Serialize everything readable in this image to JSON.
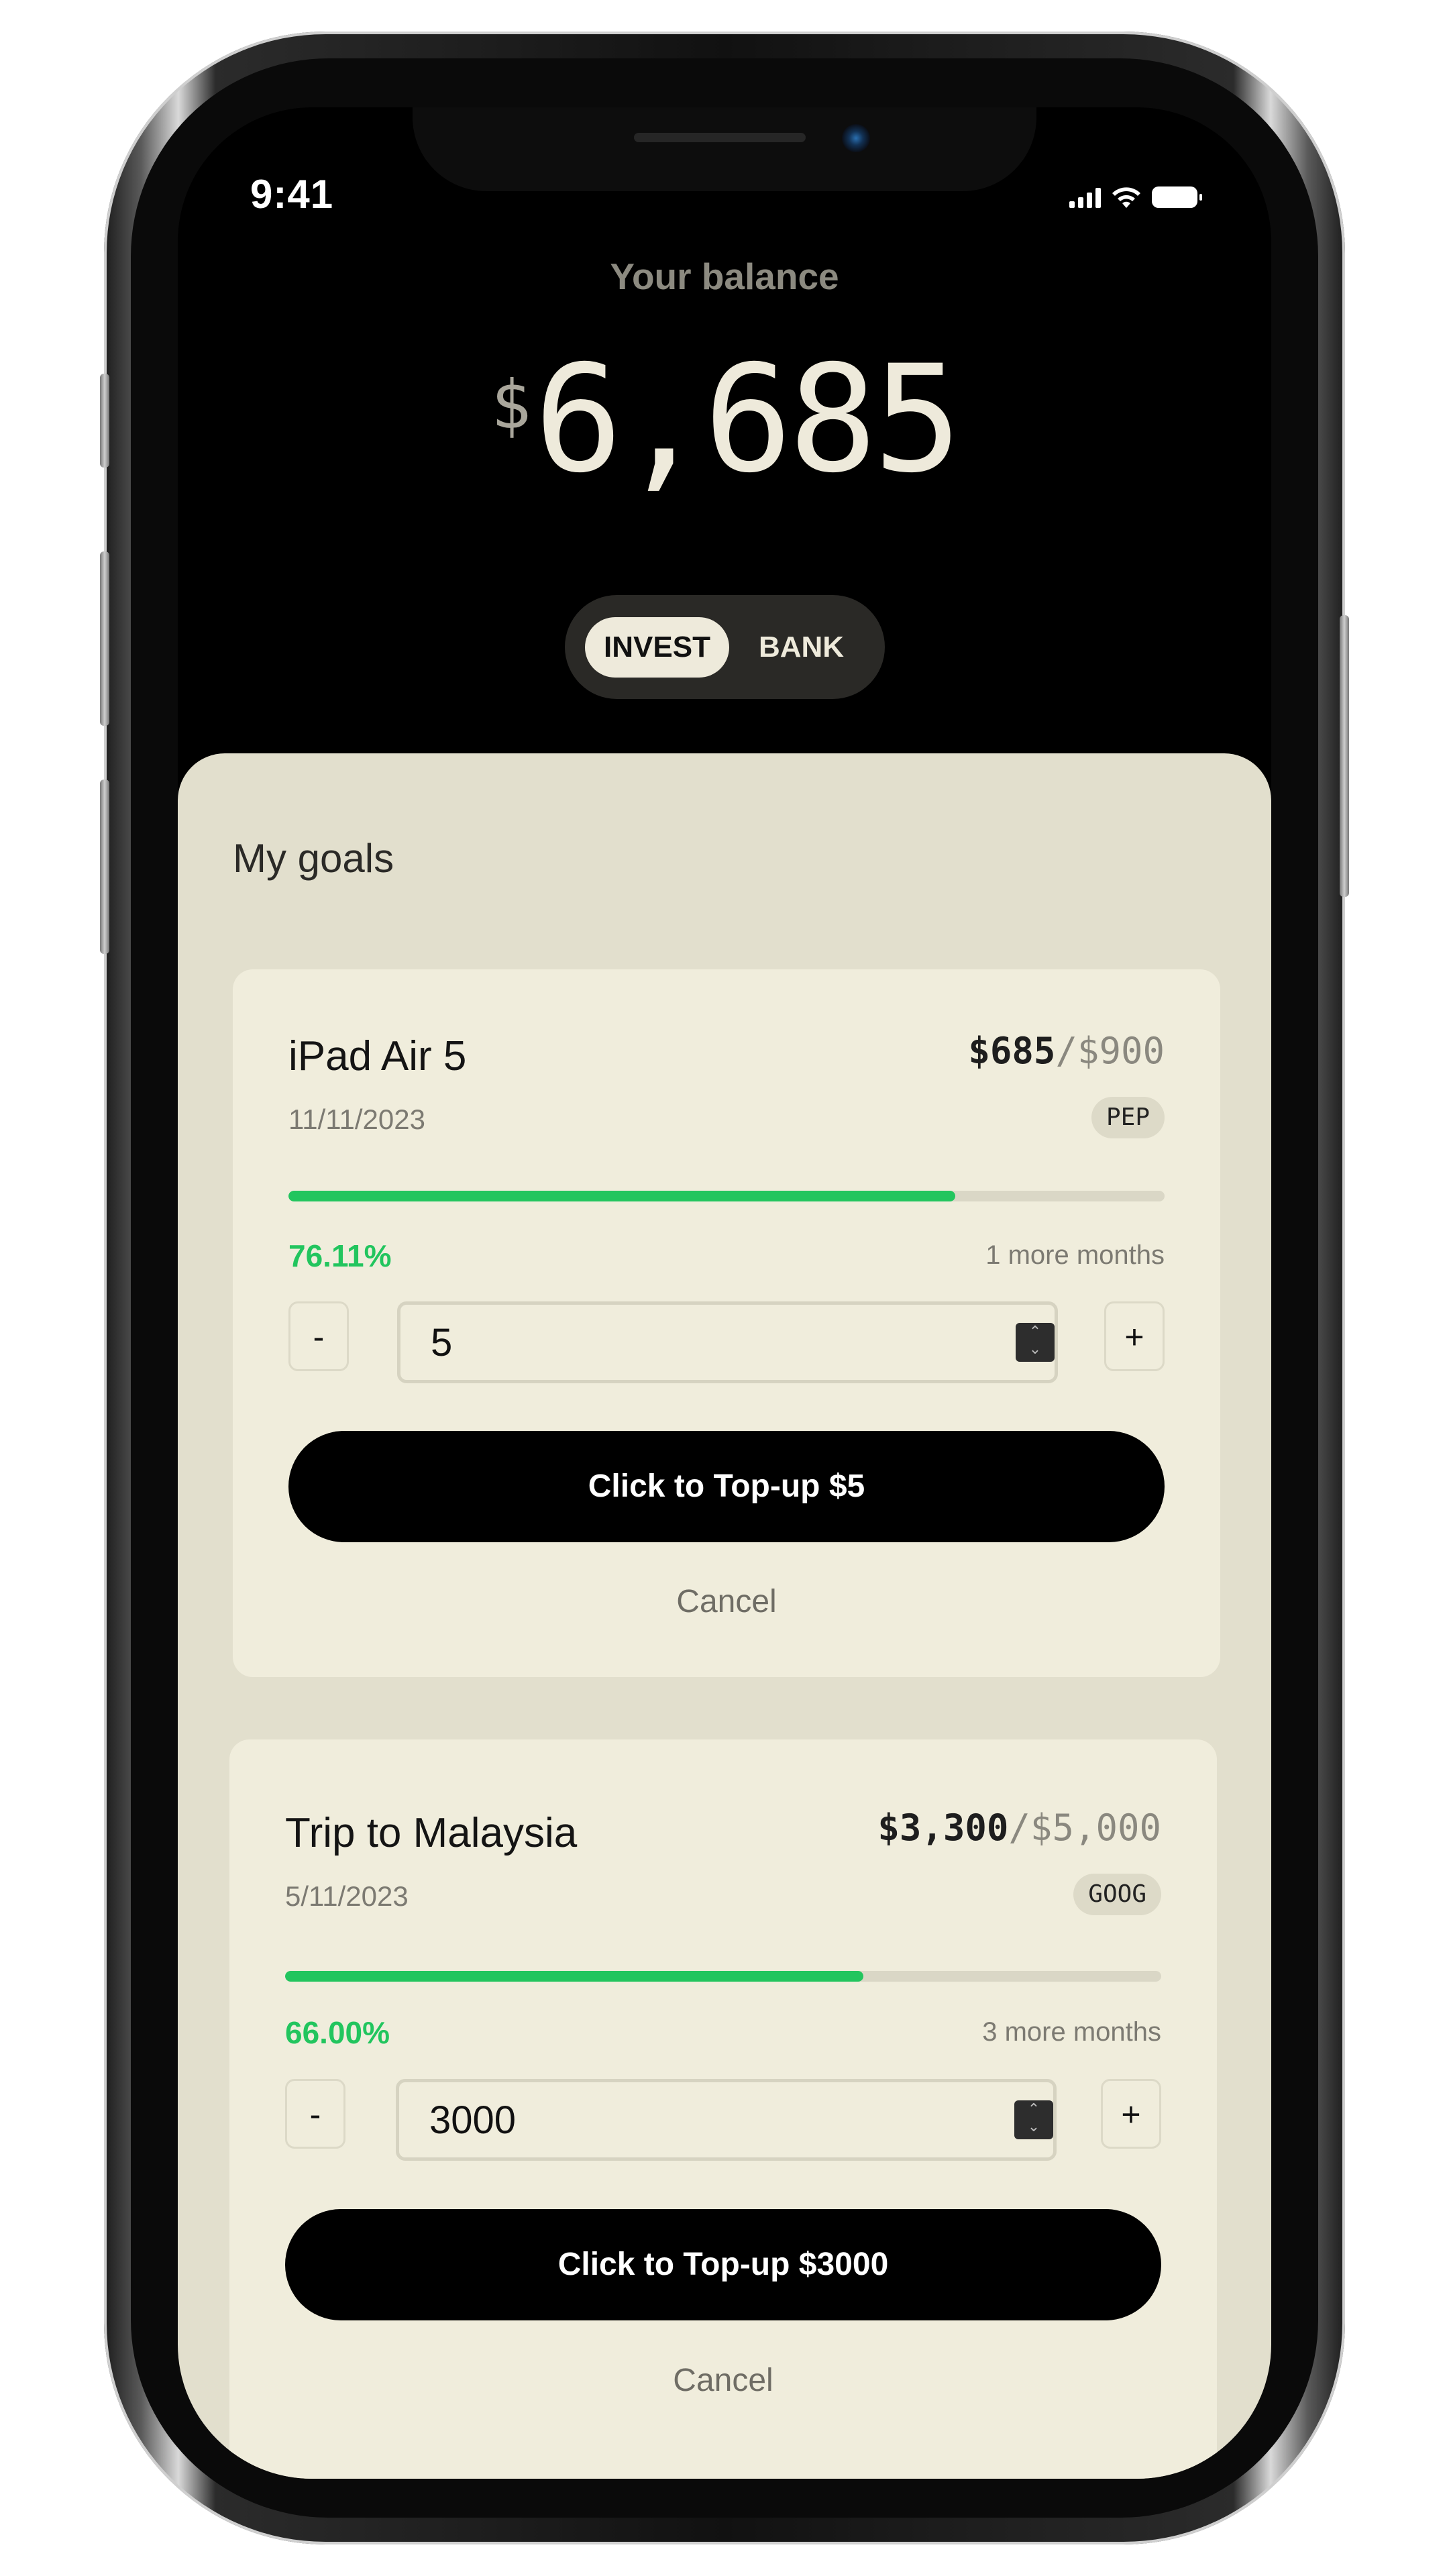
{
  "status_bar": {
    "time": "9:41"
  },
  "header": {
    "balance_label": "Your balance",
    "currency_symbol": "$",
    "balance": "6,685",
    "tabs": [
      {
        "label": "INVEST",
        "active": true
      },
      {
        "label": "BANK",
        "active": false
      }
    ]
  },
  "goals": {
    "title": "My goals",
    "items": [
      {
        "name": "iPad Air 5",
        "saved": "$685",
        "target": "/$900",
        "date": "11/11/2023",
        "ticker": "PEP",
        "progress_pct": 76.11,
        "progress_label": "76.11%",
        "remaining": "1 more months",
        "minus_label": "-",
        "plus_label": "+",
        "amount_value": "5",
        "topup_label": "Click to Top-up $5",
        "cancel_label": "Cancel"
      },
      {
        "name": "Trip to Malaysia",
        "saved": "$3,300",
        "target": "/$5,000",
        "date": "5/11/2023",
        "ticker": "GOOG",
        "progress_pct": 66.0,
        "progress_label": "66.00%",
        "remaining": "3 more months",
        "minus_label": "-",
        "plus_label": "+",
        "amount_value": "3000",
        "topup_label": "Click to Top-up $3000",
        "cancel_label": "Cancel"
      }
    ]
  },
  "colors": {
    "accent_green": "#22c55e",
    "card_bg": "#f0eddc",
    "sheet_bg": "#e2dfcd",
    "balance_text": "#eeeadb"
  }
}
